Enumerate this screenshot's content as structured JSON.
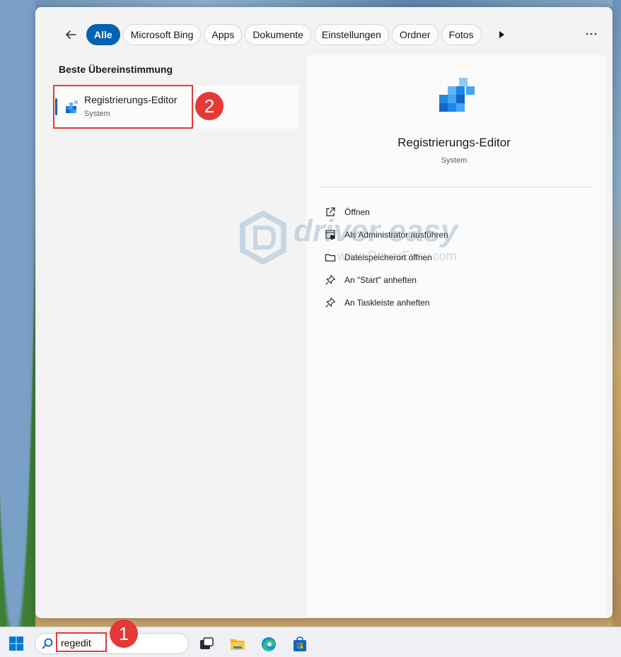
{
  "filters": {
    "back_icon": "arrow-left-icon",
    "chips": [
      {
        "label": "Alle",
        "active": true
      },
      {
        "label": "Microsoft Bing",
        "active": false
      },
      {
        "label": "Apps",
        "active": false
      },
      {
        "label": "Dokumente",
        "active": false
      },
      {
        "label": "Einstellungen",
        "active": false
      },
      {
        "label": "Ordner",
        "active": false
      },
      {
        "label": "Fotos",
        "active": false
      }
    ],
    "more_icon": "play-right-icon",
    "options_icon": "ellipsis-icon"
  },
  "results": {
    "heading": "Beste Übereinstimmung",
    "best_match": {
      "title": "Registrierungs-Editor",
      "subtitle": "System",
      "icon": "registry-editor-icon"
    }
  },
  "detail": {
    "title": "Registrierungs-Editor",
    "subtitle": "System",
    "actions": [
      {
        "label": "Öffnen",
        "icon": "open-external-icon"
      },
      {
        "label": "Als Administrator ausführen",
        "icon": "admin-shield-icon"
      },
      {
        "label": "Dateispeicherort öffnen",
        "icon": "folder-icon"
      },
      {
        "label": "An \"Start\" anheften",
        "icon": "pin-icon"
      },
      {
        "label": "An Taskleiste anheften",
        "icon": "pin-icon"
      }
    ]
  },
  "annotations": {
    "step1": "1",
    "step2": "2"
  },
  "watermark": {
    "brand": "driver easy",
    "url": "www.DriverEasy.com"
  },
  "taskbar": {
    "search_value": "regedit",
    "icons": [
      "windows-start-icon",
      "task-view-icon",
      "file-explorer-icon",
      "edge-browser-icon",
      "microsoft-store-icon"
    ]
  },
  "colors": {
    "accent": "#0063b1",
    "annotation_red": "#e53935"
  }
}
